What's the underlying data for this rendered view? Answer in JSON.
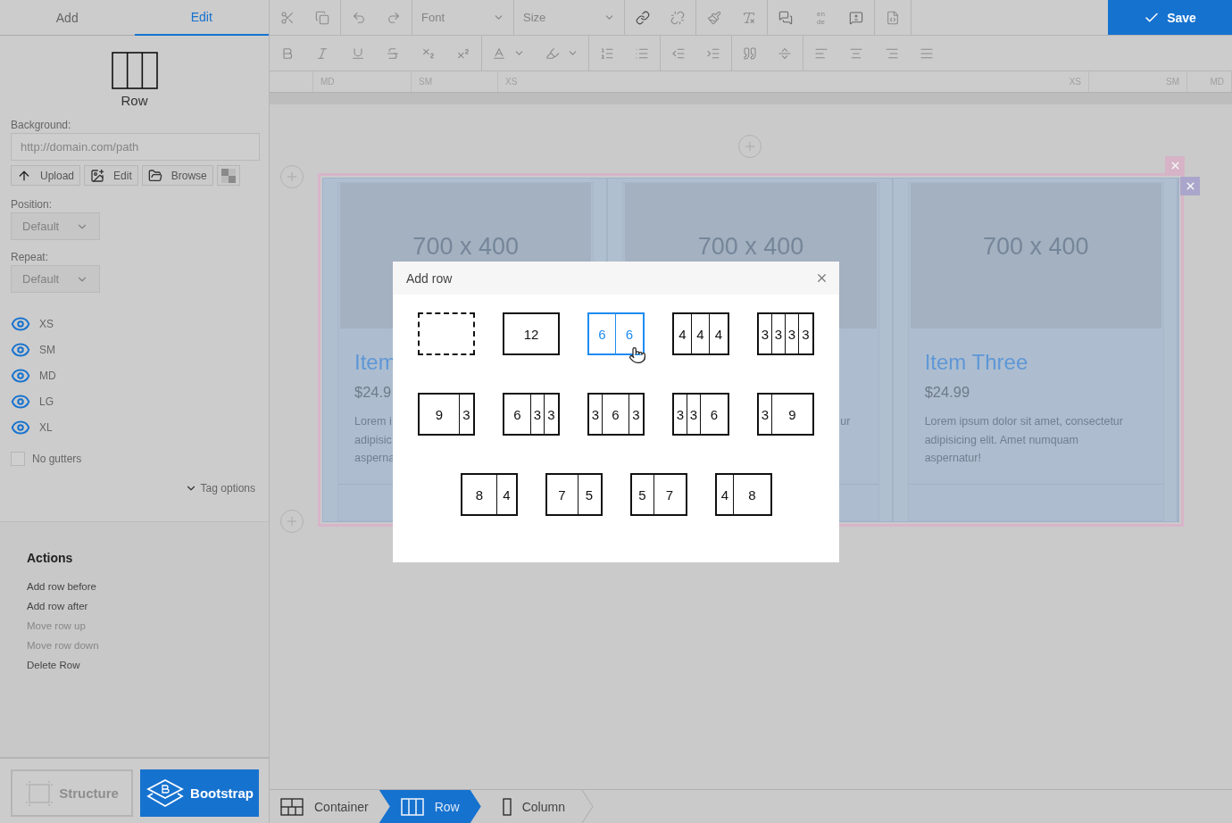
{
  "sidebar": {
    "tabs": [
      {
        "label": "Add",
        "selected": false
      },
      {
        "label": "Edit",
        "selected": true
      }
    ],
    "element": {
      "label": "Row"
    },
    "background": {
      "label": "Background:",
      "placeholder": "http://domain.com/path",
      "buttons": [
        {
          "kind": "upload",
          "label": "Upload"
        },
        {
          "kind": "edit",
          "label": "Edit"
        },
        {
          "kind": "browse",
          "label": "Browse"
        },
        {
          "kind": "checker"
        }
      ]
    },
    "position": {
      "label": "Position:",
      "value": "Default",
      "disabled": true
    },
    "repeat": {
      "label": "Repeat:",
      "value": "Default",
      "disabled": true
    },
    "visibility": [
      {
        "label": "XS",
        "on": true
      },
      {
        "label": "SM",
        "on": true
      },
      {
        "label": "MD",
        "on": true
      },
      {
        "label": "LG",
        "on": true
      },
      {
        "label": "XL",
        "on": true
      }
    ],
    "no_gutters": {
      "label": "No gutters",
      "checked": false
    },
    "tag_options": {
      "label": "Tag options",
      "expanded": false
    },
    "actions": {
      "title": "Actions",
      "items": [
        {
          "label": "Add row before",
          "disabled": false
        },
        {
          "label": "Add row after",
          "disabled": false
        },
        {
          "label": "Move row up",
          "disabled": true
        },
        {
          "label": "Move row down",
          "disabled": true
        },
        {
          "label": "Delete Row",
          "disabled": false
        }
      ]
    },
    "modes": [
      {
        "kind": "structure",
        "label": "Structure",
        "selected": false
      },
      {
        "kind": "bootstrap",
        "label": "Bootstrap",
        "selected": true
      }
    ]
  },
  "toolbar": {
    "font": {
      "placeholder": "Font"
    },
    "size": {
      "placeholder": "Size"
    },
    "language": {
      "from": "en",
      "to": "de"
    },
    "save": "Save"
  },
  "ruler": [
    "MD",
    "SM",
    "XS",
    "XS",
    "SM",
    "MD"
  ],
  "canvas": {
    "cards": [
      {
        "image": "700 x 400",
        "title": "Item",
        "price": "$24.9",
        "text": [
          "Lorem i",
          "adipisic",
          "asperna"
        ]
      },
      {
        "image": "700 x 400",
        "text": [
          "ur"
        ]
      },
      {
        "image": "700 x 400",
        "title": "Item Three",
        "price": "$24.99",
        "text": [
          "Lorem ipsum dolor sit amet, consectetur",
          "adipisicing elit. Amet numquam",
          "aspernatur!"
        ]
      }
    ]
  },
  "modal": {
    "title": "Add row",
    "layouts": [
      {
        "kind": "empty",
        "selected": false
      },
      {
        "kind": "cols",
        "selected": false,
        "cells": [
          "12"
        ]
      },
      {
        "kind": "cols",
        "selected": true,
        "cells": [
          "6",
          "6"
        ]
      },
      {
        "kind": "cols",
        "selected": false,
        "cells": [
          "4",
          "4",
          "4"
        ]
      },
      {
        "kind": "cols",
        "selected": false,
        "cells": [
          "3",
          "3",
          "3",
          "3"
        ]
      },
      {
        "kind": "cols",
        "selected": false,
        "cells": [
          "9",
          "3"
        ]
      },
      {
        "kind": "cols",
        "selected": false,
        "cells": [
          "6",
          "3",
          "3"
        ]
      },
      {
        "kind": "cols",
        "selected": false,
        "cells": [
          "3",
          "6",
          "3"
        ]
      },
      {
        "kind": "cols",
        "selected": false,
        "cells": [
          "3",
          "3",
          "6"
        ]
      },
      {
        "kind": "cols",
        "selected": false,
        "cells": [
          "3",
          "9"
        ]
      },
      {
        "kind": "cols",
        "selected": false,
        "cells": [
          "8",
          "4"
        ]
      },
      {
        "kind": "cols",
        "selected": false,
        "cells": [
          "7",
          "5"
        ]
      },
      {
        "kind": "cols",
        "selected": false,
        "cells": [
          "5",
          "7"
        ]
      },
      {
        "kind": "cols",
        "selected": false,
        "cells": [
          "4",
          "8"
        ]
      }
    ]
  },
  "breadcrumb": [
    {
      "kind": "container",
      "label": "Container",
      "selected": false
    },
    {
      "kind": "row",
      "label": "Row",
      "selected": true
    },
    {
      "kind": "column",
      "label": "Column",
      "selected": false
    }
  ]
}
